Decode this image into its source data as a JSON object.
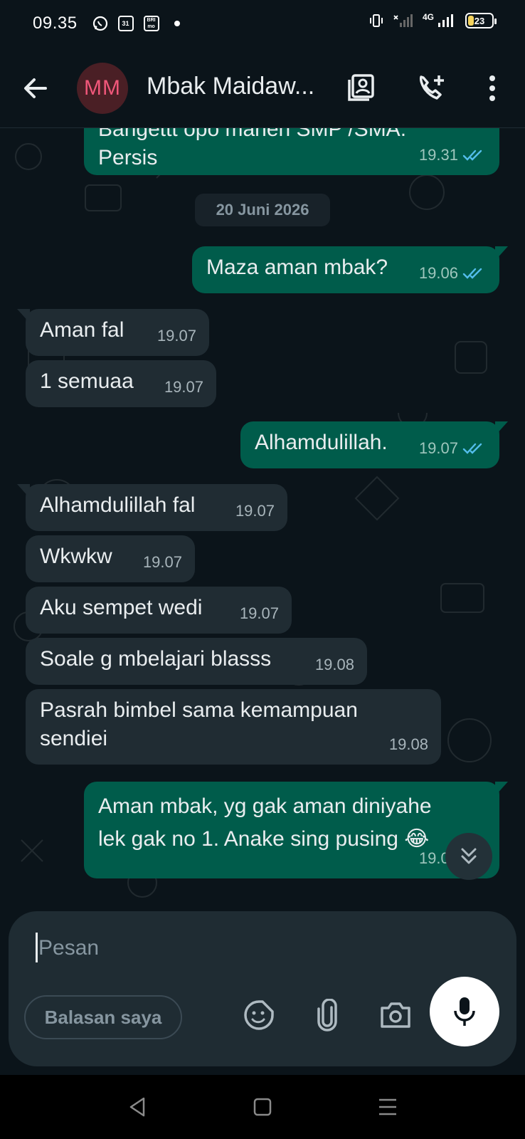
{
  "status_bar": {
    "time": "09.35",
    "icons": [
      "whatsapp-icon",
      "calendar-icon",
      "brimo-icon",
      "dot-icon"
    ],
    "calendar_label": "31",
    "brimo_label": "BRI mo",
    "network": "4G",
    "battery_level": "23"
  },
  "header": {
    "avatar_initials": "MM",
    "contact_name": "Mbak Maidaw...",
    "icons": [
      "back-arrow-icon",
      "contact-card-icon",
      "add-call-icon",
      "more-vertical-icon"
    ]
  },
  "chat": {
    "date_separator": "20 Juni 2026",
    "messages": [
      {
        "dir": "out",
        "text": "Bangettt opo maneh SMP /SMA.\nPersis",
        "time": "19.31",
        "read": true
      },
      {
        "dir": "out",
        "text": "Maza aman mbak?",
        "time": "19.06",
        "read": true
      },
      {
        "dir": "in",
        "text": "Aman fal",
        "time": "19.07"
      },
      {
        "dir": "in",
        "text": "1 semuaa",
        "time": "19.07"
      },
      {
        "dir": "out",
        "text": "Alhamdulillah.",
        "time": "19.07",
        "read": true
      },
      {
        "dir": "in",
        "text": "Alhamdulillah fal",
        "time": "19.07"
      },
      {
        "dir": "in",
        "text": "Wkwkw",
        "time": "19.07"
      },
      {
        "dir": "in",
        "text": "Aku sempet wedi",
        "time": "19.07"
      },
      {
        "dir": "in",
        "text": "Soale g mbelajari blasss",
        "time": "19.08"
      },
      {
        "dir": "in",
        "text": "Pasrah bimbel sama kemampuan\nsendiei",
        "time": "19.08"
      },
      {
        "dir": "out",
        "text": "Aman mbak, yg gak aman diniyahe\nlek gak no 1. Anake sing pusing 😂",
        "time": "19.09",
        "read": true
      }
    ]
  },
  "composer": {
    "placeholder": "Pesan",
    "value": "",
    "quick_reply_label": "Balasan saya",
    "icons": [
      "sticker-icon",
      "attach-icon",
      "camera-icon",
      "mic-icon"
    ]
  },
  "colors": {
    "background": "#0b141a",
    "outgoing_bubble": "#005c4b",
    "incoming_bubble": "#202c33",
    "read_tick": "#53bdeb",
    "avatar_bg": "#4a1f25",
    "avatar_text": "#f0577a"
  },
  "nav": {
    "icons": [
      "nav-back-icon",
      "nav-home-icon",
      "nav-recents-icon"
    ]
  }
}
